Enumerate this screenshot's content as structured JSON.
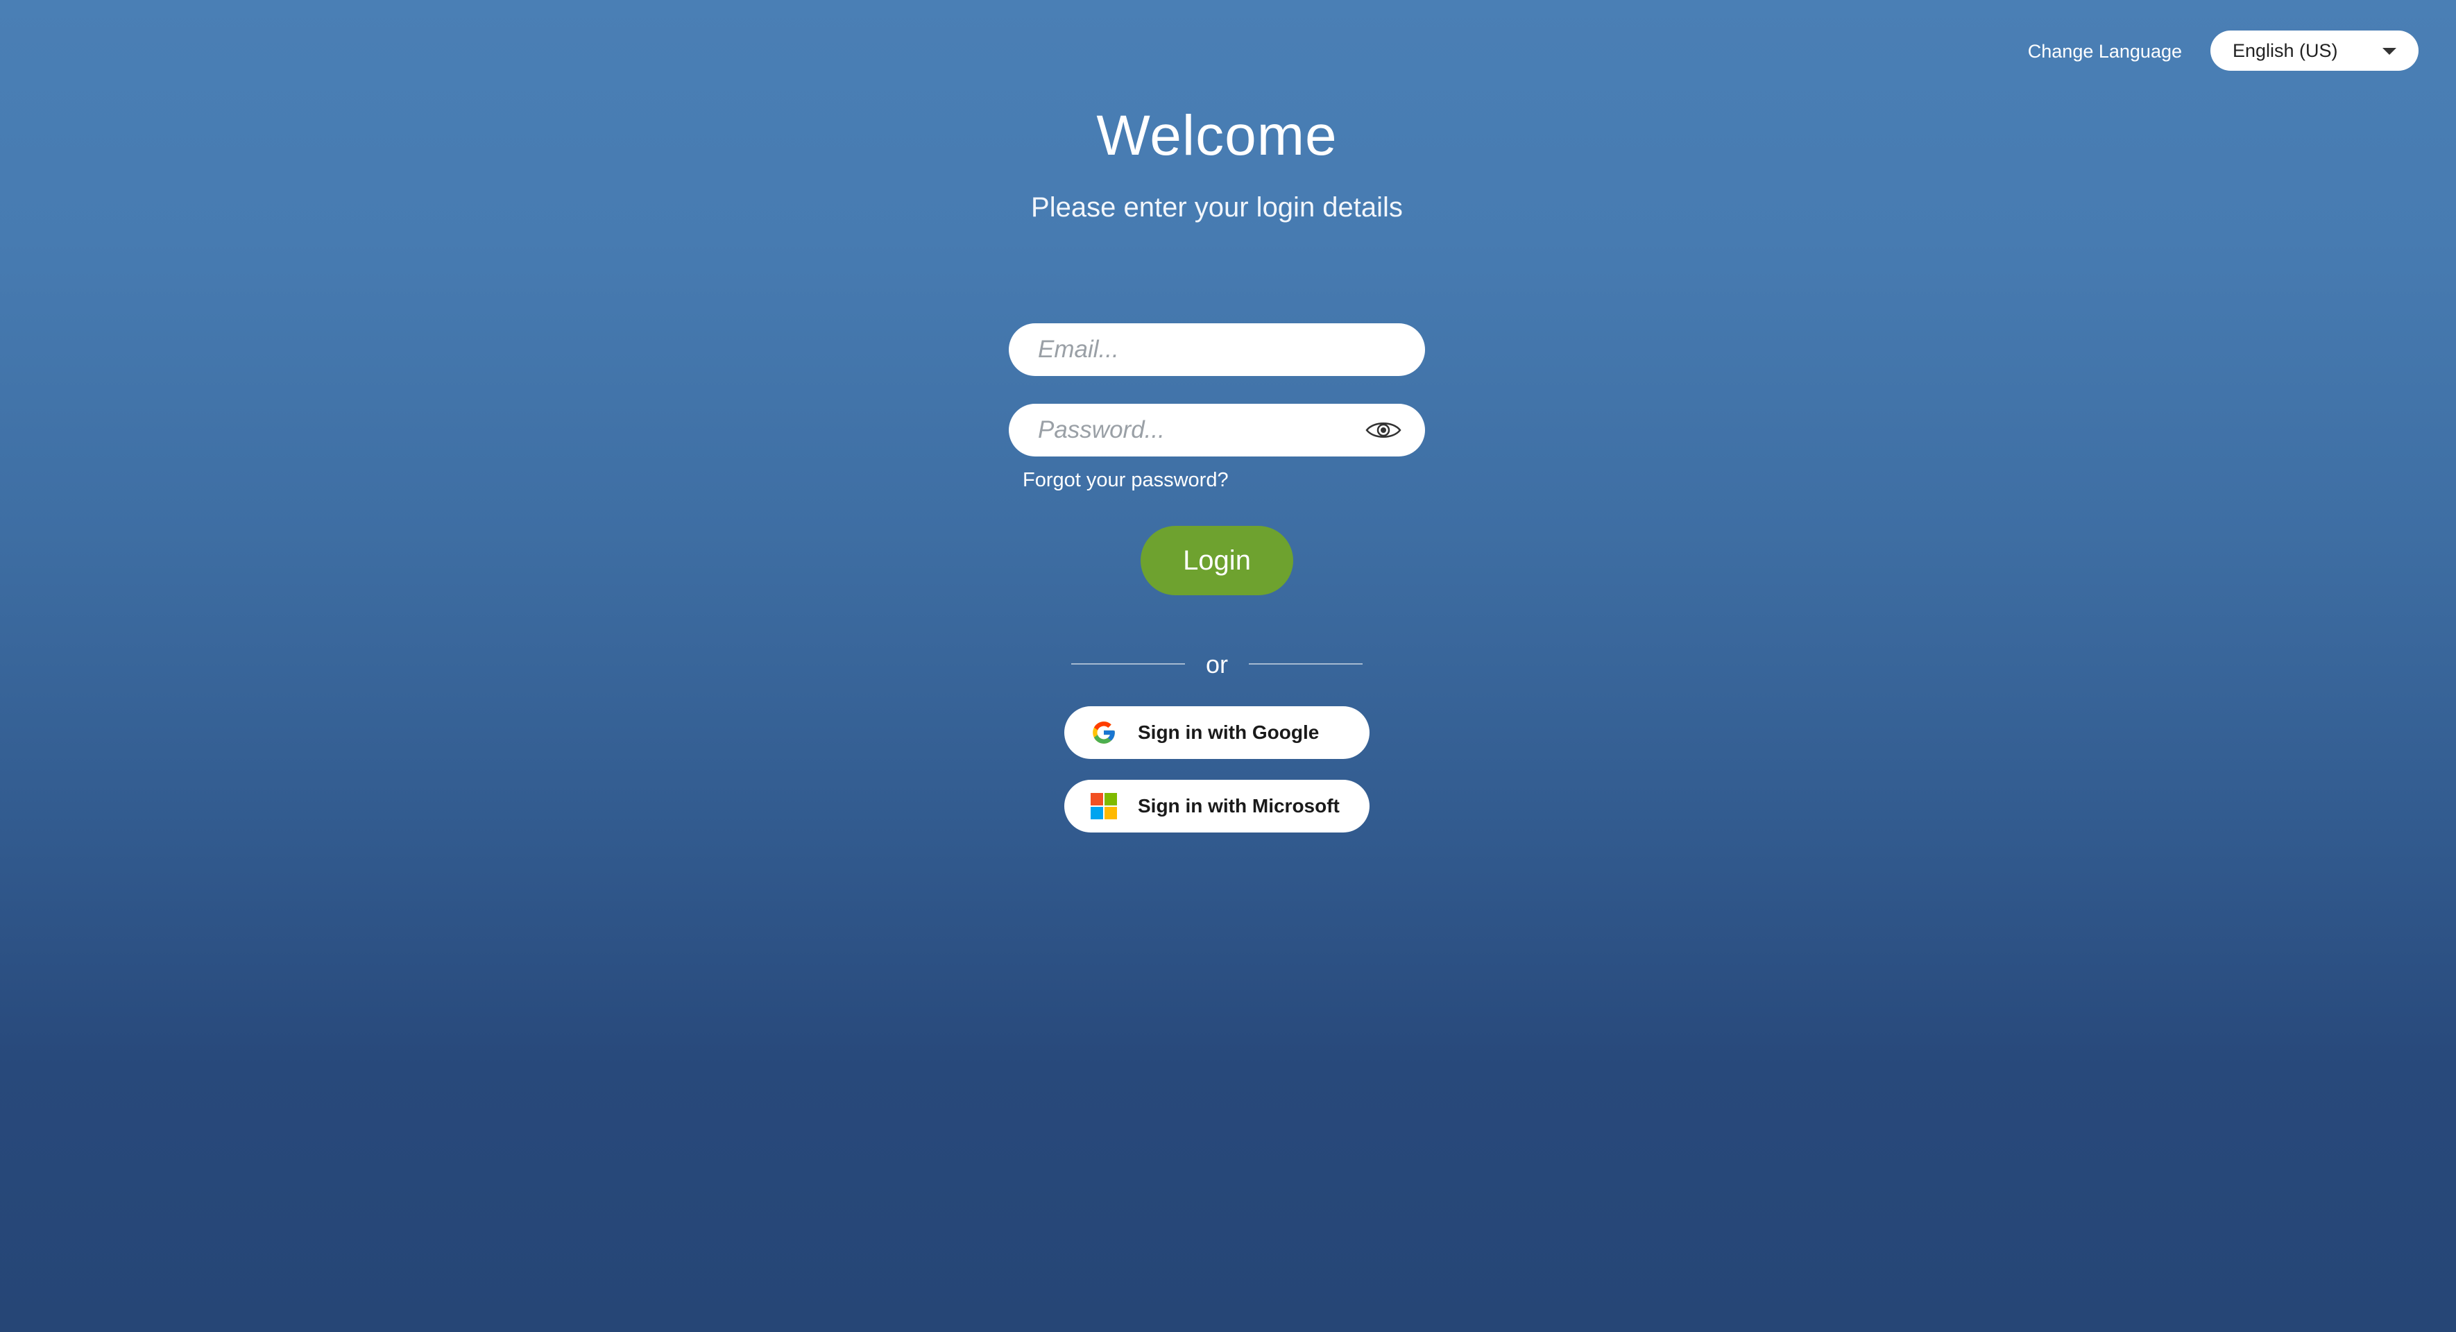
{
  "language": {
    "label": "Change Language",
    "selected": "English (US)"
  },
  "header": {
    "title": "Welcome",
    "subtitle": "Please enter your login details"
  },
  "form": {
    "email_placeholder": "Email...",
    "email_value": "",
    "password_placeholder": "Password...",
    "password_value": "",
    "forgot_link": "Forgot your password?",
    "login_button": "Login"
  },
  "divider": {
    "text": "or"
  },
  "sso": {
    "google_label": "Sign in with Google",
    "microsoft_label": "Sign in with Microsoft"
  },
  "icons": {
    "password_toggle": "eye-icon",
    "language_caret": "caret-down-icon",
    "google": "google-logo-icon",
    "microsoft": "microsoft-logo-icon"
  },
  "colors": {
    "background_top": "#4a7fb5",
    "background_bottom": "#264676",
    "login_button": "#6ea22f",
    "field_background": "#ffffff"
  }
}
